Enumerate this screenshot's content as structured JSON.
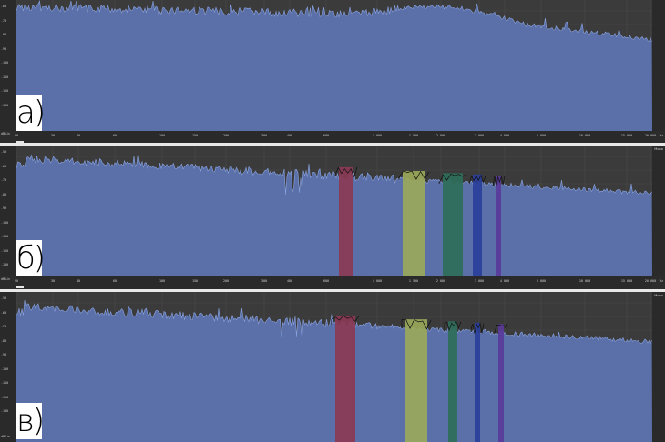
{
  "panels": [
    {
      "id": "a",
      "label": "а)",
      "channel_label": "",
      "y_ticks": [
        "-60",
        "-70",
        "-80",
        "-90",
        "-100",
        "-110",
        "-120",
        "-130"
      ],
      "x_ticks": [
        "20",
        "30",
        "40",
        "60",
        "100",
        "150",
        "200",
        "300",
        "400",
        "600",
        "1 000",
        "1 500",
        "2 000",
        "3 000",
        "4 000",
        "6 000",
        "10 000",
        "15 000",
        "20 000"
      ],
      "x_unit": "Hz",
      "corner_label": "dB  Lin",
      "bands": []
    },
    {
      "id": "b",
      "label": "б)",
      "channel_label": "Mono",
      "y_ticks": [
        "-50",
        "-60",
        "-70",
        "-80",
        "-90",
        "-100",
        "-110",
        "-120",
        "-130"
      ],
      "x_ticks": [
        "20",
        "30",
        "40",
        "60",
        "100",
        "150",
        "200",
        "300",
        "400",
        "600",
        "1 000",
        "1 500",
        "2 000",
        "3 000",
        "4 000",
        "6 000",
        "10 000",
        "15 000",
        "20 000"
      ],
      "x_unit": "Hz",
      "corner_label": "dB  Lin",
      "bands": [
        {
          "color": "#8a3a55",
          "name": "red-band"
        },
        {
          "color": "#9aa85a",
          "name": "yellow-band"
        },
        {
          "color": "#2f6e5a",
          "name": "green-band"
        },
        {
          "color": "#2a3f9a",
          "name": "blue-band"
        },
        {
          "color": "#5a3a9a",
          "name": "purple-band"
        }
      ]
    },
    {
      "id": "v",
      "label": "в)",
      "channel_label": "Mono",
      "y_ticks": [
        "-50",
        "-60",
        "-70",
        "-80",
        "-90",
        "-100",
        "-110",
        "-120",
        "-130"
      ],
      "x_ticks": [],
      "x_unit": "",
      "corner_label": "dB  Lin",
      "bands": [
        {
          "color": "#8a3a55",
          "name": "red-band"
        },
        {
          "color": "#9aa85a",
          "name": "yellow-band"
        },
        {
          "color": "#2f6e5a",
          "name": "green-band"
        },
        {
          "color": "#2a3f9a",
          "name": "blue-band"
        },
        {
          "color": "#5a3a9a",
          "name": "purple-band"
        }
      ]
    }
  ],
  "colors": {
    "spectrum_fill": "#5b6fa8",
    "spectrum_line": "#8aa4e0",
    "grid": "#4a4a4a",
    "plot_bg": "#3b3b3b"
  }
}
